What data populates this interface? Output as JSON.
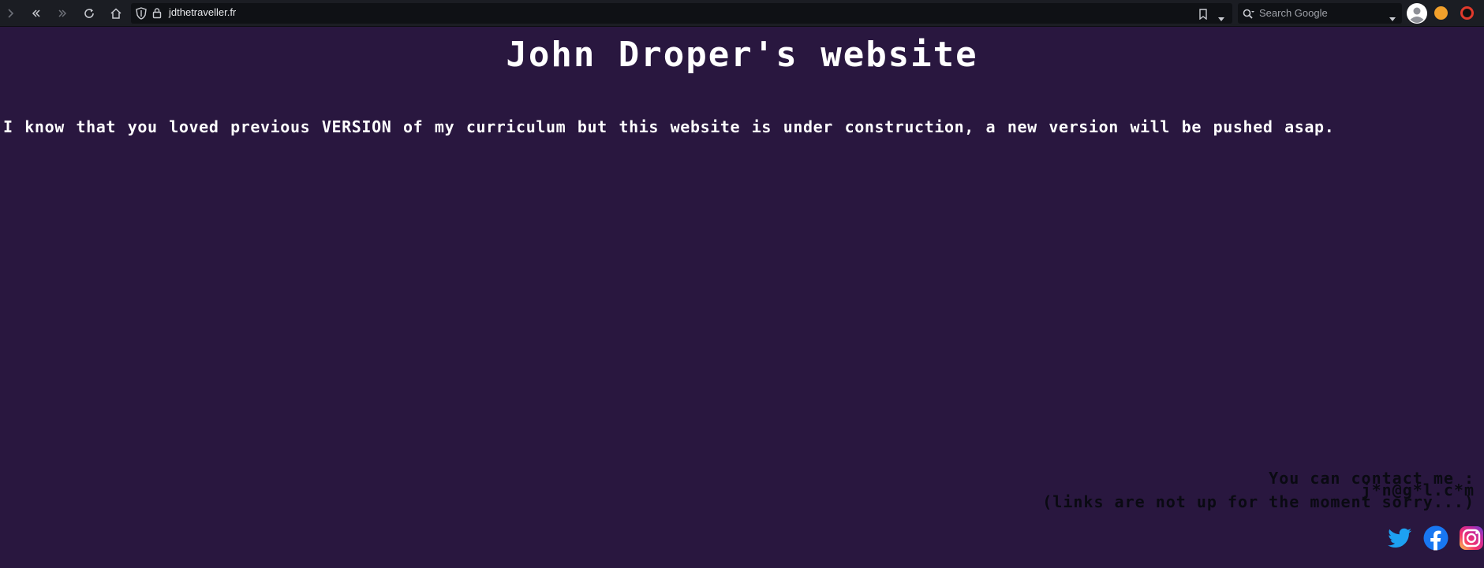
{
  "browser": {
    "url": "jdthetraveller.fr",
    "search_placeholder": "Search Google",
    "icons": [
      "forward-icon",
      "back-history-icon",
      "forward-history-icon",
      "reload-icon",
      "home-icon",
      "shield-icon",
      "lock-icon",
      "bookmark-icon",
      "dropdown-icon",
      "search-icon",
      "profile-icon",
      "extension-icon"
    ]
  },
  "page": {
    "title": "John Droper's website",
    "intro": "I know that you loved previous VERSION of my curriculum but this website is under construction, a new version will be pushed asap.",
    "contact": {
      "line1": "You can contact me :",
      "line2": "j*n@g*l.c*m",
      "line3": "(links are not up for the moment sorry...)"
    },
    "social": [
      "twitter-icon",
      "facebook-icon",
      "instagram-icon"
    ]
  },
  "colors": {
    "background": "#29173f",
    "title": "#ffffff",
    "contact_text": "#0a0a12",
    "twitter": "#1da1f2",
    "facebook": "#1877f2"
  }
}
